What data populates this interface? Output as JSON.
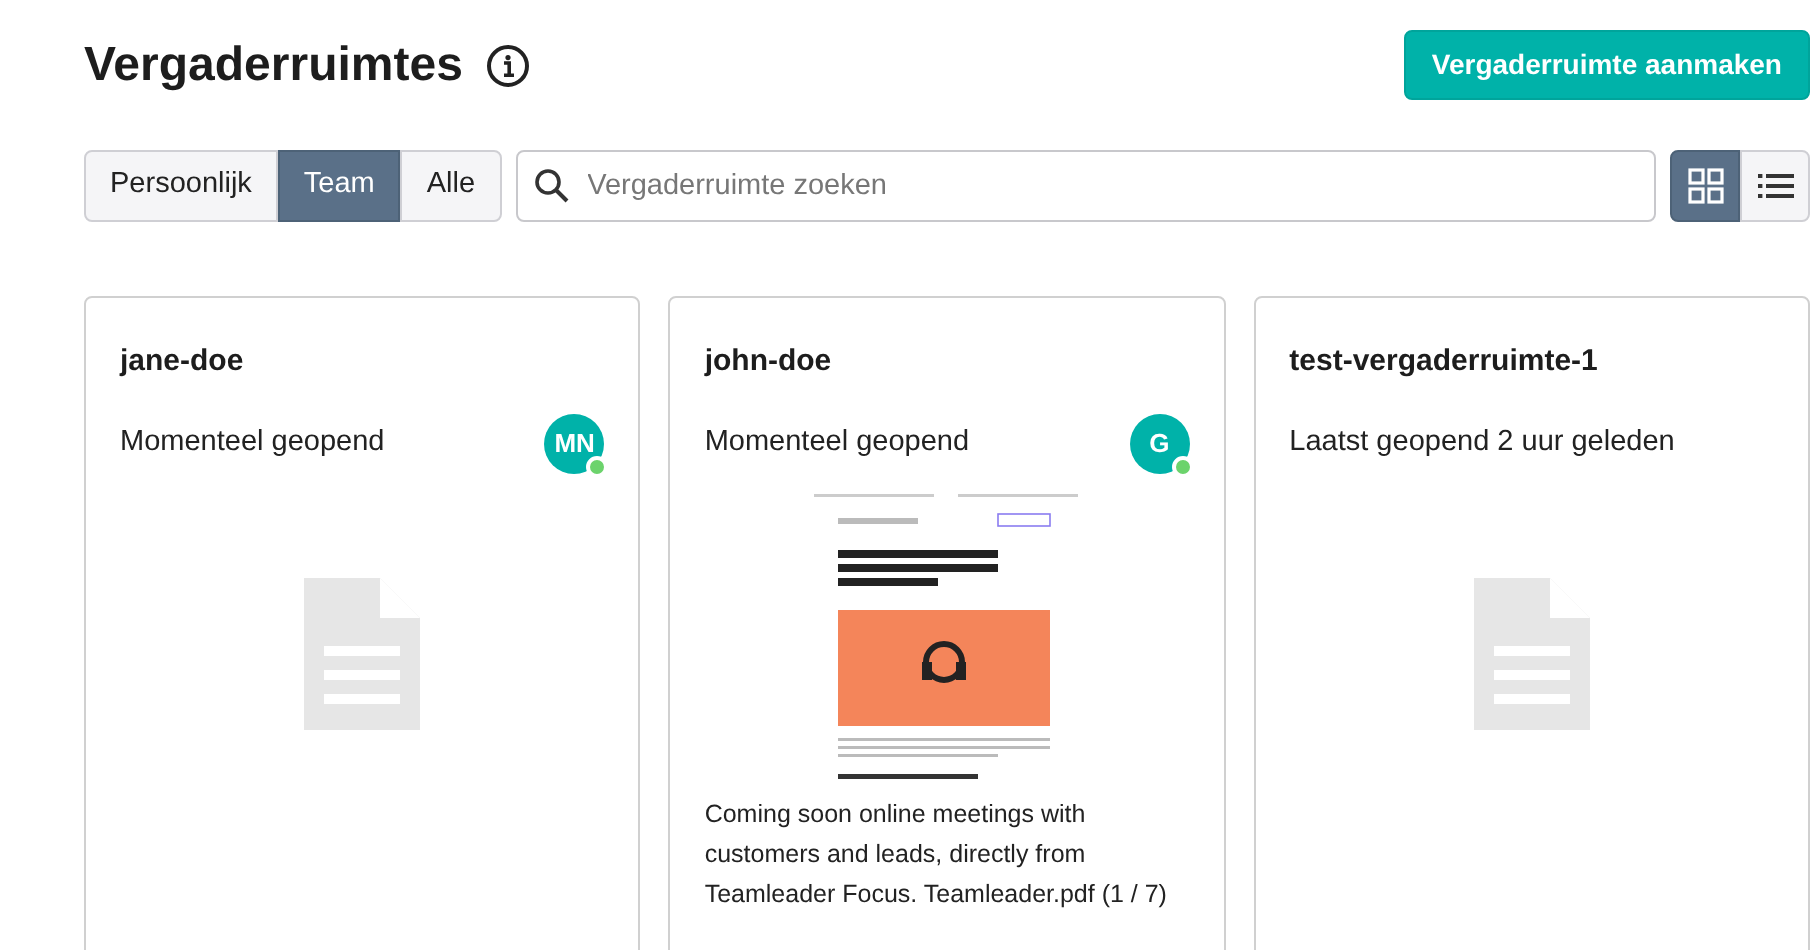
{
  "header": {
    "title": "Vergaderruimtes",
    "create_button": "Vergaderruimte aanmaken"
  },
  "filters": [
    {
      "label": "Persoonlijk",
      "selected": false
    },
    {
      "label": "Team",
      "selected": true
    },
    {
      "label": "Alle",
      "selected": false
    }
  ],
  "search": {
    "placeholder": "Vergaderruimte zoeken"
  },
  "view_toggle": [
    {
      "kind": "grid",
      "selected": true
    },
    {
      "kind": "list",
      "selected": false
    }
  ],
  "rooms": [
    {
      "name": "jane-doe",
      "status": "Momenteel geopend",
      "avatar": {
        "initials": "MN",
        "online": true
      },
      "preview": {
        "kind": "placeholder"
      }
    },
    {
      "name": "john-doe",
      "status": "Momenteel geopend",
      "avatar": {
        "initials": "G",
        "online": true
      },
      "preview": {
        "kind": "document",
        "caption": "Coming soon online meetings with customers and leads, directly from Teamleader Focus. Teamleader.pdf (1 / 7)"
      }
    },
    {
      "name": "test-vergaderruimte-1",
      "status": "Laatst geopend 2 uur geleden",
      "preview": {
        "kind": "placeholder"
      }
    }
  ]
}
